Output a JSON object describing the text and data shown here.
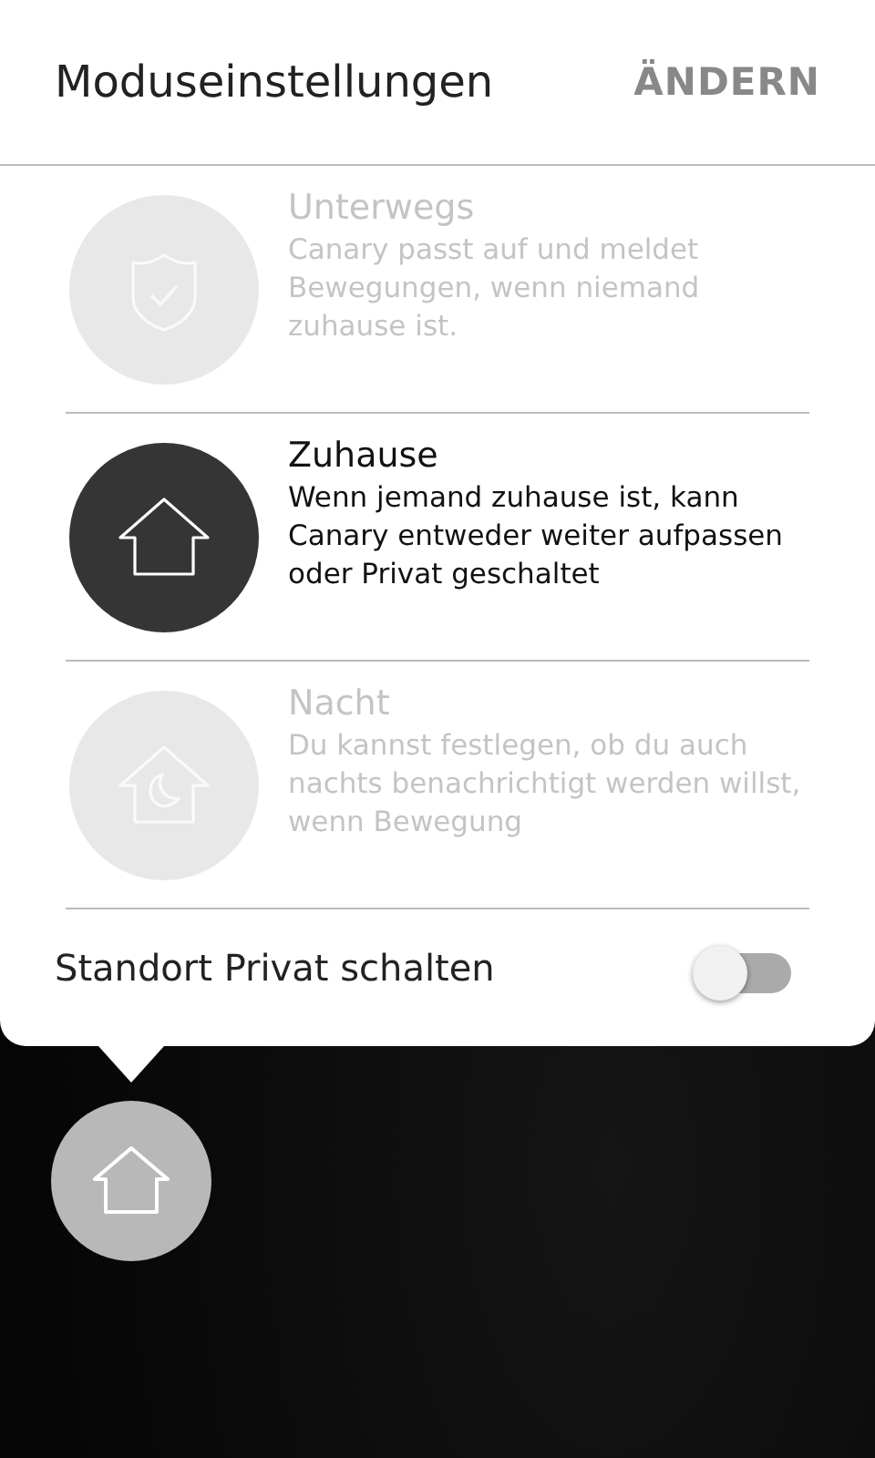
{
  "header": {
    "title": "Moduseinstellungen",
    "action": "ÄNDERN"
  },
  "modes": [
    {
      "kind": "away",
      "title": "Unterwegs",
      "description": "Canary passt auf und meldet Bewegungen, wenn niemand zuhause ist.",
      "selected": false
    },
    {
      "kind": "home",
      "title": "Zuhause",
      "description": "Wenn jemand zuhause ist, kann Canary entweder weiter aufpassen oder Privat geschaltet",
      "selected": true
    },
    {
      "kind": "night",
      "title": "Nacht",
      "description": "Du kannst festlegen, ob du auch nachts benachrichtigt werden willst, wenn Bewegung",
      "selected": false
    }
  ],
  "privacy": {
    "label": "Standort Privat schalten",
    "on": false
  }
}
